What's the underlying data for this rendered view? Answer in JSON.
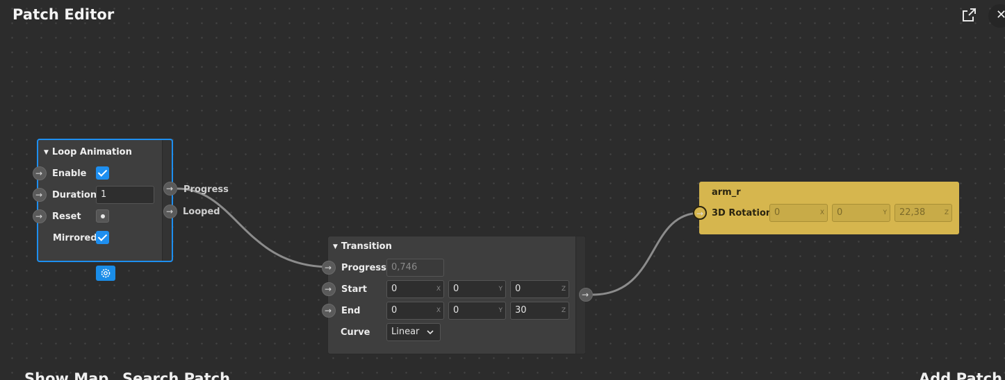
{
  "header": {
    "title": "Patch Editor"
  },
  "loop_node": {
    "title": "Loop Animation",
    "inputs": [
      {
        "label": "Enable"
      },
      {
        "label": "Duration",
        "value": "1"
      },
      {
        "label": "Reset"
      },
      {
        "label": "Mirrored"
      }
    ],
    "outputs": [
      {
        "label": "Progress"
      },
      {
        "label": "Looped"
      }
    ]
  },
  "transition_node": {
    "title": "Transition",
    "progress": {
      "label": "Progress",
      "value": "0,746"
    },
    "start": {
      "label": "Start",
      "x": "0",
      "y": "0",
      "z": "0"
    },
    "end": {
      "label": "End",
      "x": "0",
      "y": "0",
      "z": "30"
    },
    "curve": {
      "label": "Curve",
      "value": "Linear"
    }
  },
  "arm_node": {
    "title": "arm_r",
    "rotation": {
      "label": "3D Rotation",
      "x": "0",
      "y": "0",
      "z": "22,38"
    }
  },
  "axis_labels": {
    "x": "X",
    "y": "Y",
    "z": "Z"
  },
  "footer": {
    "show_map": "Show Map",
    "search_patch": "Search Patch",
    "add_patch": "Add Patch"
  },
  "colors": {
    "accent": "#1e8ff0",
    "object_node": "#d6b64e",
    "canvas": "#2c2c2c"
  }
}
